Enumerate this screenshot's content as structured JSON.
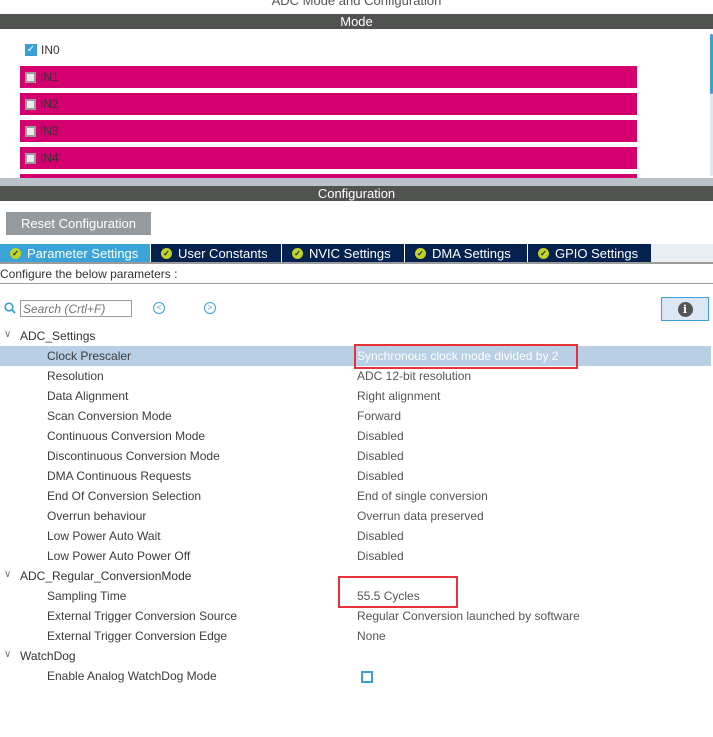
{
  "window": {
    "title": "ADC Mode and Configuration"
  },
  "mode": {
    "header": "Mode",
    "channels": [
      {
        "label": "IN0",
        "checked": true
      },
      {
        "label": "IN1",
        "checked": false
      },
      {
        "label": "IN2",
        "checked": false
      },
      {
        "label": "IN3",
        "checked": false
      },
      {
        "label": "IN4",
        "checked": false
      }
    ],
    "channel_highlight_color": "#d4006f"
  },
  "configuration": {
    "header": "Configuration",
    "reset_button": "Reset Configuration",
    "tabs": [
      {
        "label": "Parameter Settings",
        "active": true
      },
      {
        "label": "User Constants",
        "active": false
      },
      {
        "label": "NVIC Settings",
        "active": false
      },
      {
        "label": "DMA Settings",
        "active": false
      },
      {
        "label": "GPIO Settings",
        "active": false
      }
    ],
    "instructions": "Configure the below parameters :",
    "search": {
      "placeholder": "Search (Crtl+F)",
      "value": ""
    },
    "groups": [
      {
        "name": "ADC_Settings",
        "params": [
          {
            "name": "Clock Prescaler",
            "value": "Synchronous clock mode divided by 2",
            "selected": true
          },
          {
            "name": "Resolution",
            "value": "ADC 12-bit resolution"
          },
          {
            "name": "Data Alignment",
            "value": "Right alignment"
          },
          {
            "name": "Scan Conversion Mode",
            "value": "Forward"
          },
          {
            "name": "Continuous Conversion Mode",
            "value": "Disabled"
          },
          {
            "name": "Discontinuous Conversion Mode",
            "value": "Disabled"
          },
          {
            "name": "DMA Continuous Requests",
            "value": "Disabled"
          },
          {
            "name": "End Of Conversion Selection",
            "value": "End of single conversion"
          },
          {
            "name": "Overrun behaviour",
            "value": "Overrun data preserved"
          },
          {
            "name": "Low Power Auto Wait",
            "value": "Disabled"
          },
          {
            "name": "Low Power Auto Power Off",
            "value": "Disabled"
          }
        ]
      },
      {
        "name": "ADC_Regular_ConversionMode",
        "params": [
          {
            "name": "Sampling Time",
            "value": "55.5 Cycles"
          },
          {
            "name": "External Trigger Conversion Source",
            "value": "Regular Conversion launched by software"
          },
          {
            "name": "External Trigger Conversion Edge",
            "value": "None"
          }
        ]
      },
      {
        "name": "WatchDog",
        "params": [
          {
            "name": "Enable Analog WatchDog Mode",
            "value": "",
            "checkbox": true,
            "checked": false
          }
        ]
      }
    ],
    "icons": {
      "search": "search-icon",
      "prev": "chevron-left-circle-icon",
      "next": "chevron-right-circle-icon",
      "info": "info-icon",
      "tab_check": "check-circle-icon",
      "expand": "chevron-down-icon"
    },
    "highlight_color": "#e8323a"
  }
}
